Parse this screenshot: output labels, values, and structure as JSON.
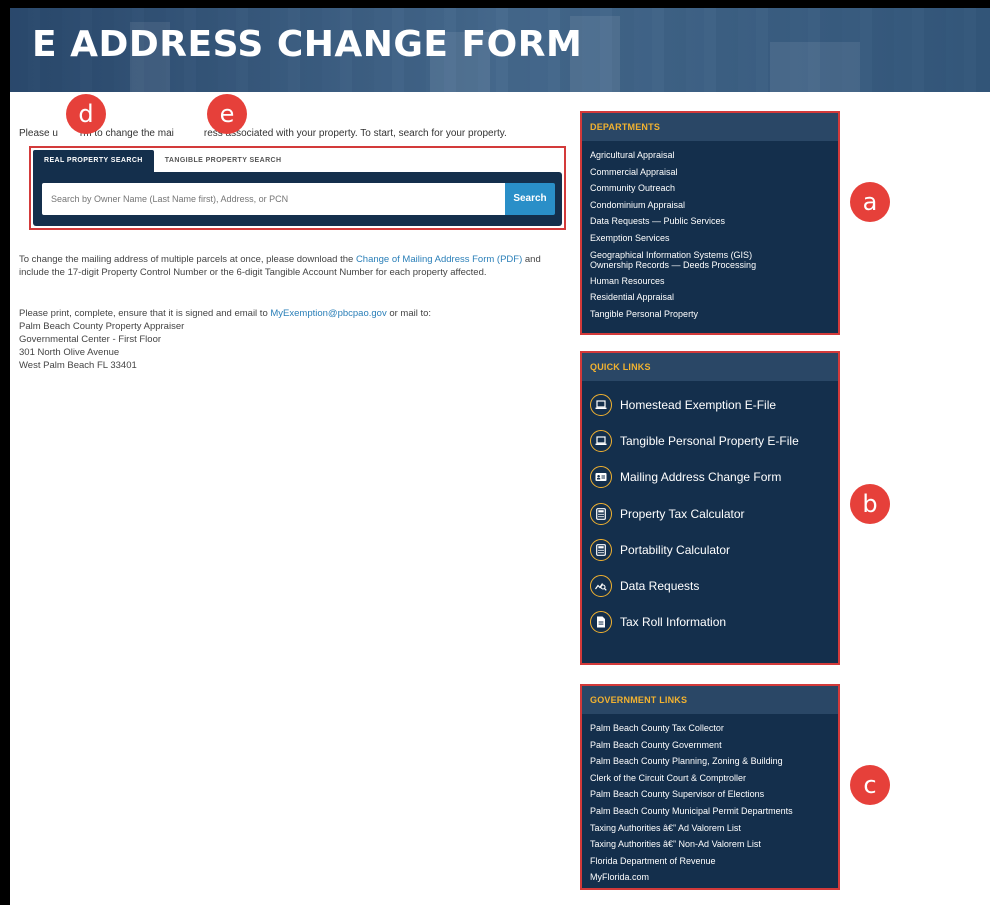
{
  "header": {
    "title": "E ADDRESS CHANGE FORM"
  },
  "intro": {
    "text_a": "Please u",
    "text_b": "rm to change the mai",
    "text_c": "ress associated with your property. To start, search for your property."
  },
  "search": {
    "tabs": [
      {
        "label": "REAL PROPERTY SEARCH",
        "active": true
      },
      {
        "label": "TANGIBLE PROPERTY SEARCH",
        "active": false
      }
    ],
    "placeholder": "Search by Owner Name (Last Name first), Address, or PCN",
    "button_label": "Search"
  },
  "multiple_parcels": {
    "before_link": "To change the mailing address of multiple parcels at once, please download the ",
    "link_text": "Change of Mailing Address Form (PDF)",
    "after_link": " and include the 17-digit Property Control Number or the 6-digit Tangible Account Number for each property affected."
  },
  "print_note": {
    "before_link": "Please print, complete, ensure that it is signed and email to ",
    "link_text": "MyExemption@pbcpao.gov",
    "after_link": " or mail to:",
    "address": [
      "Palm Beach County Property Appraiser",
      "Governmental Center - First Floor",
      "301 North Olive Avenue",
      "West Palm Beach FL 33401"
    ]
  },
  "departments": {
    "title": "DEPARTMENTS",
    "items": [
      "Agricultural Appraisal",
      "Commercial Appraisal",
      "Community Outreach",
      "Condominium Appraisal",
      "Data Requests — Public Services",
      "Exemption Services",
      "Geographical Information Systems (GIS)",
      "Ownership Records — Deeds Processing",
      "Human Resources",
      "Residential Appraisal",
      "Tangible Personal Property"
    ]
  },
  "quick_links": {
    "title": "QUICK LINKS",
    "items": [
      {
        "label": "Homestead Exemption E-File",
        "icon": "laptop-icon"
      },
      {
        "label": "Tangible Personal Property E-File",
        "icon": "laptop-icon"
      },
      {
        "label": "Mailing Address Change Form",
        "icon": "id-card-icon"
      },
      {
        "label": "Property Tax Calculator",
        "icon": "calculator-icon"
      },
      {
        "label": "Portability Calculator",
        "icon": "calculator-icon"
      },
      {
        "label": "Data Requests",
        "icon": "chart-search-icon"
      },
      {
        "label": "Tax Roll Information",
        "icon": "document-icon"
      }
    ]
  },
  "government_links": {
    "title": "GOVERNMENT LINKS",
    "items": [
      "Palm Beach County Tax Collector",
      "Palm Beach County Government",
      "Palm Beach County Planning, Zoning & Building",
      "Clerk of the Circuit Court & Comptroller",
      "Palm Beach County Supervisor of Elections",
      "Palm Beach County Municipal Permit Departments",
      "Taxing Authorities â€” Ad Valorem List",
      "Taxing Authorities â€” Non-Ad Valorem List",
      "Florida Department of Revenue",
      "MyFlorida.com"
    ]
  },
  "annotations": [
    "a",
    "b",
    "c",
    "d",
    "e"
  ],
  "colors": {
    "navy": "#142f4c",
    "accent": "#f2b230",
    "link": "#2a7fb8",
    "search_button": "#2a8fc8",
    "badge": "#e6403a"
  }
}
